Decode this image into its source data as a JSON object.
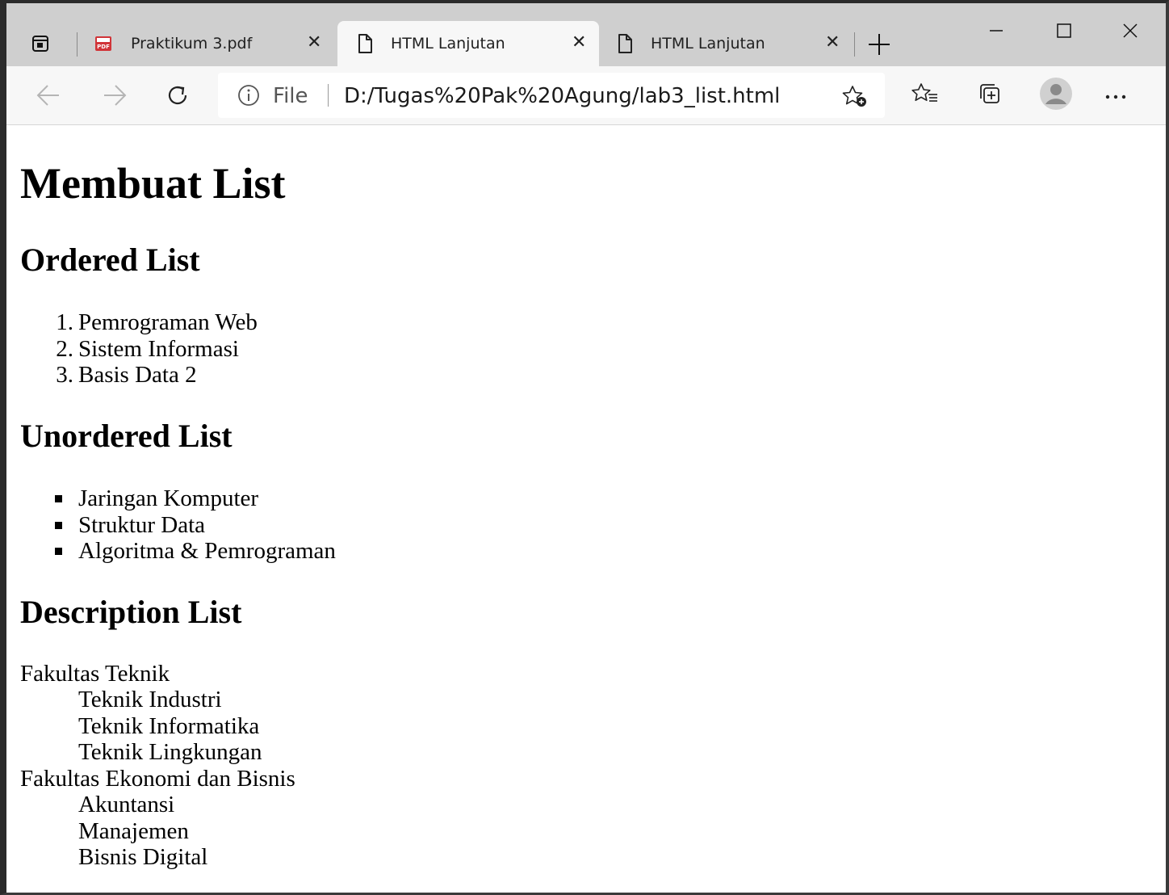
{
  "browser": {
    "tabs": [
      {
        "title": "Praktikum 3.pdf",
        "icon": "pdf-icon"
      },
      {
        "title": "HTML Lanjutan",
        "icon": "page-icon",
        "active": true
      },
      {
        "title": "HTML Lanjutan",
        "icon": "page-icon"
      }
    ],
    "address": {
      "scheme_label": "File",
      "url": "D:/Tugas%20Pak%20Agung/lab3_list.html"
    },
    "colors": {
      "tabstrip": "#cfcfcf",
      "toolbar": "#f7f7f7"
    }
  },
  "page": {
    "title": "Membuat List",
    "ordered": {
      "heading": "Ordered List",
      "items": [
        {
          "num": "1.",
          "text": "Pemrograman Web"
        },
        {
          "num": "2.",
          "text": "Sistem Informasi"
        },
        {
          "num": "3.",
          "text": "Basis Data 2"
        }
      ]
    },
    "unordered": {
      "heading": "Unordered List",
      "items": [
        "Jaringan Komputer",
        "Struktur Data",
        "Algoritma & Pemrograman"
      ]
    },
    "description": {
      "heading": "Description List",
      "terms": [
        {
          "term": "Fakultas Teknik",
          "defs": [
            "Teknik Industri",
            "Teknik Informatika",
            "Teknik Lingkungan"
          ]
        },
        {
          "term": "Fakultas Ekonomi dan Bisnis",
          "defs": [
            "Akuntansi",
            "Manajemen",
            "Bisnis Digital"
          ]
        }
      ]
    }
  }
}
